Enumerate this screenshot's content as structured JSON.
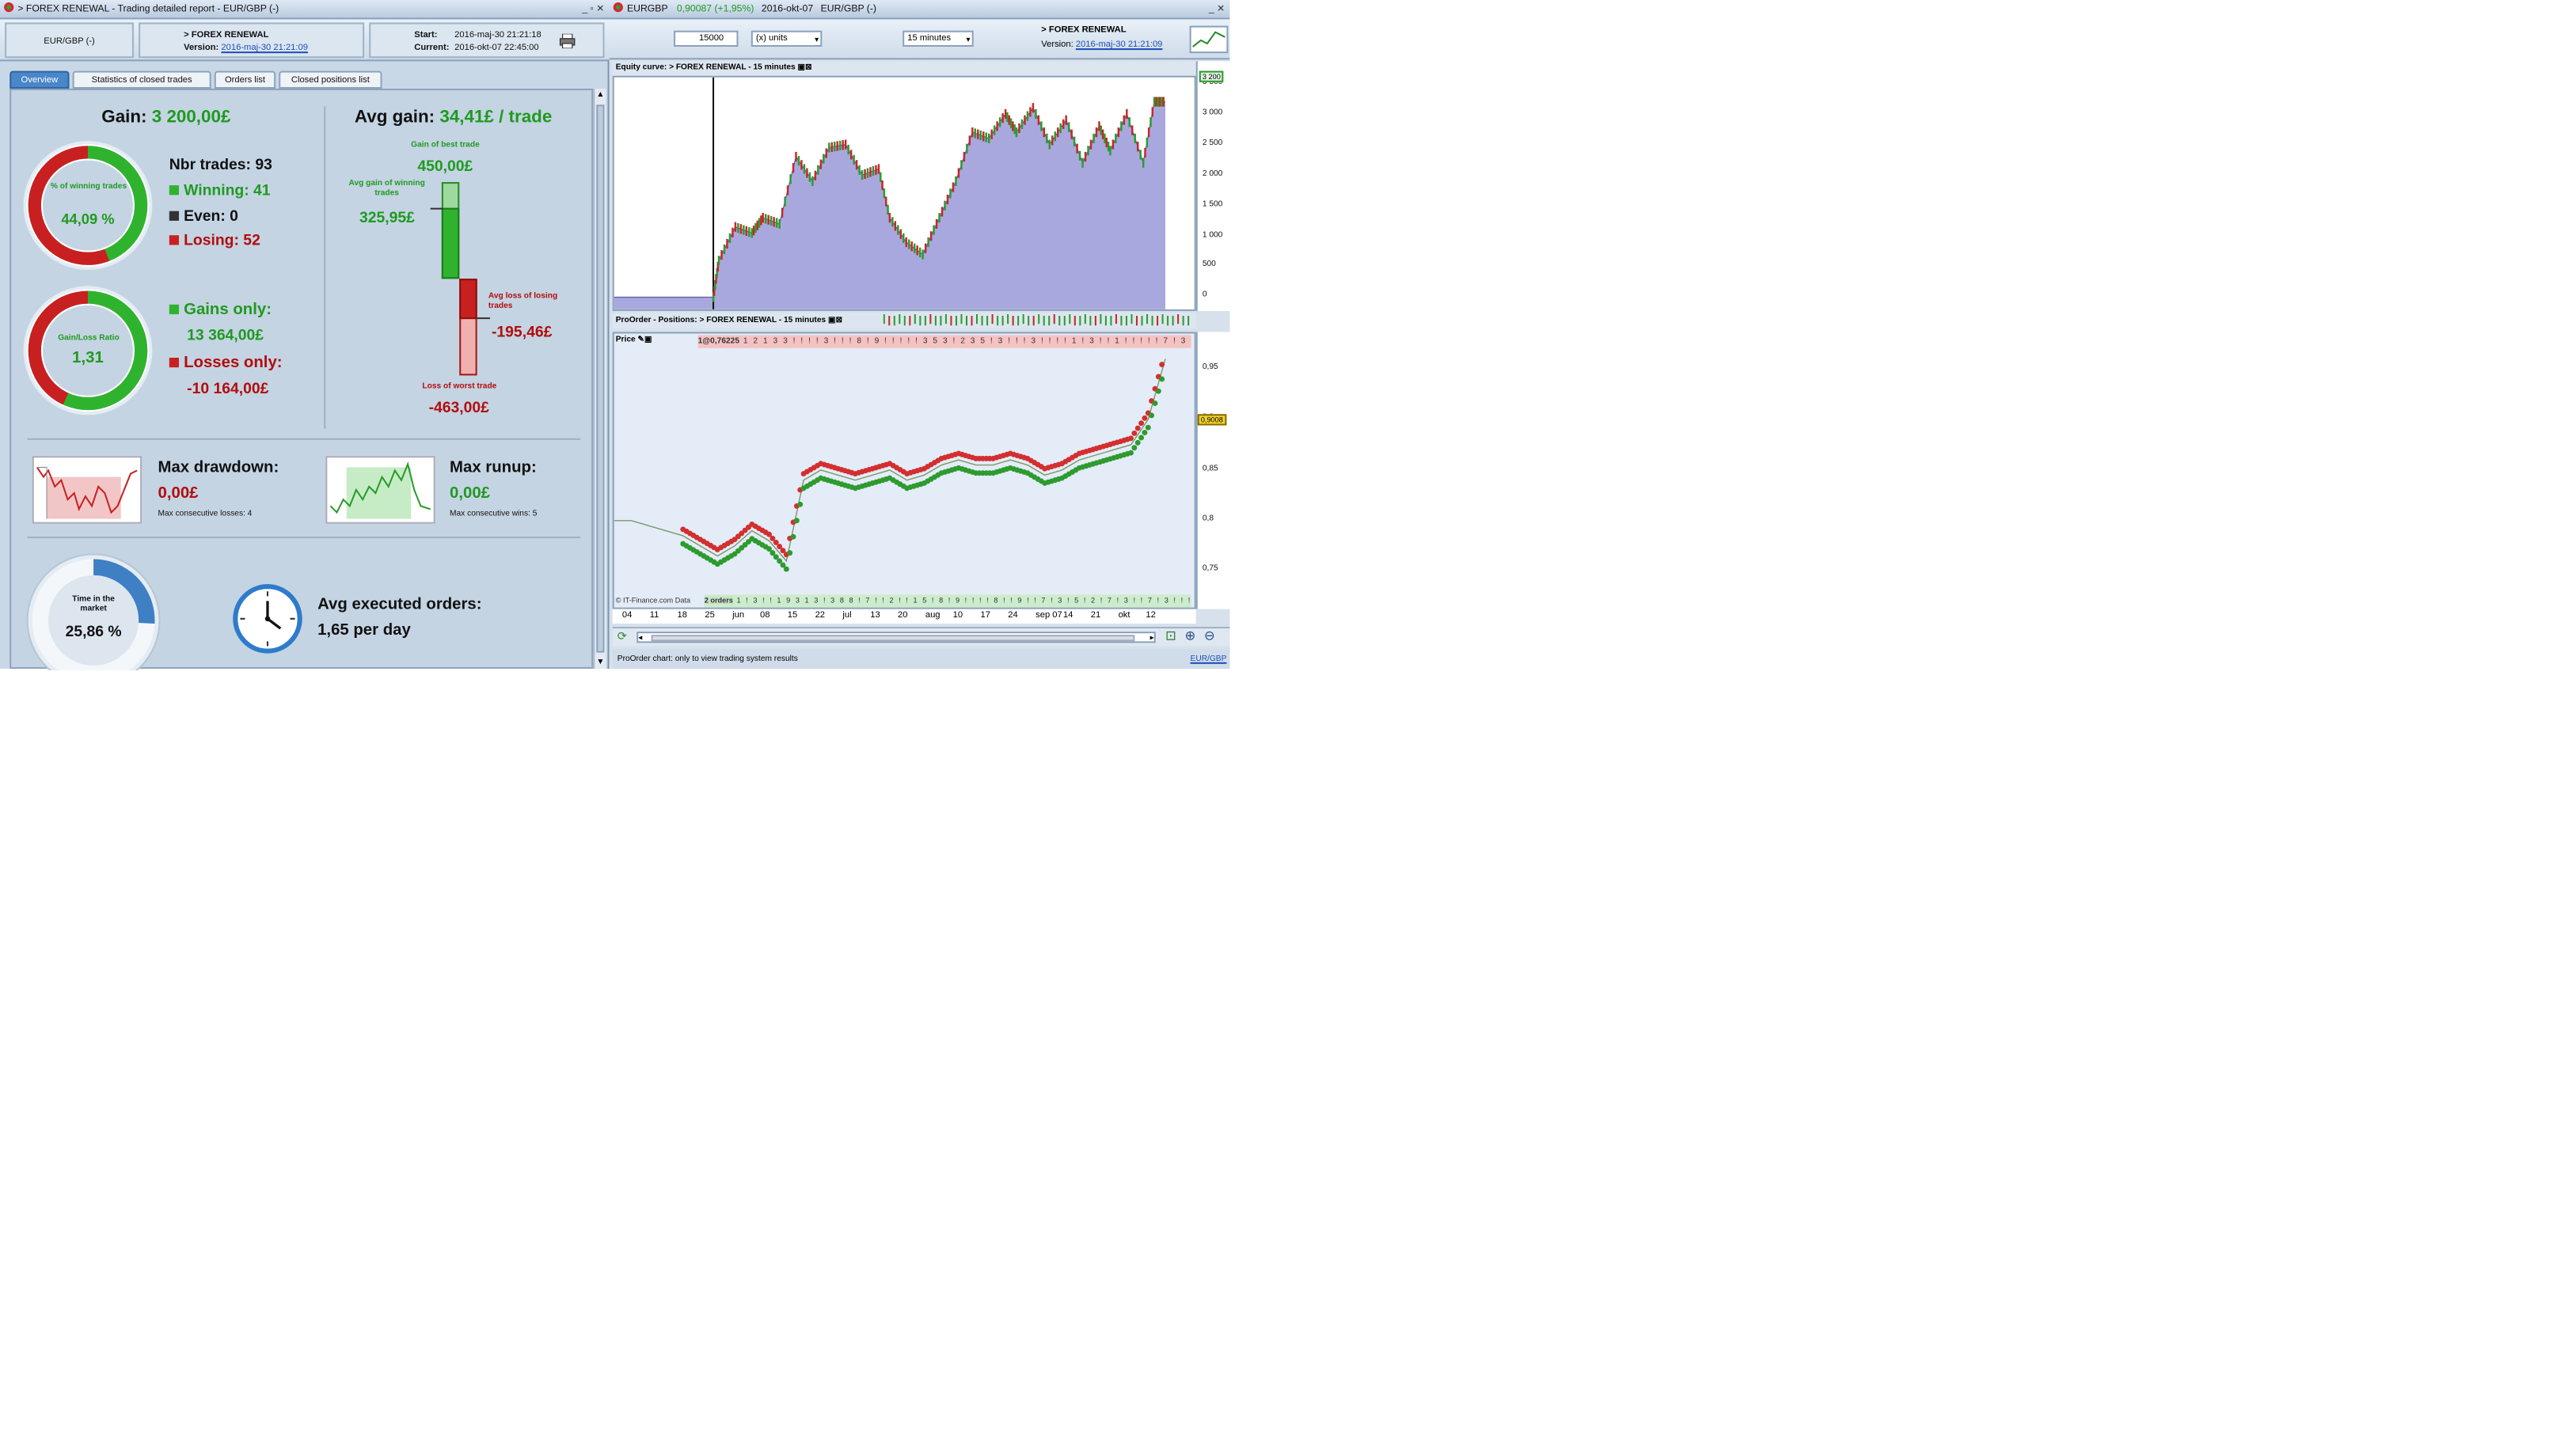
{
  "left_window": {
    "title": "> FOREX RENEWAL - Trading detailed report - EUR/GBP (-)",
    "instrument": "EUR/GBP (-)",
    "system_name": "> FOREX RENEWAL",
    "version_label": "Version:",
    "version_date": "2016-maj-30 21:21:09",
    "start_label": "Start:",
    "start_value": "2016-maj-30 21:21:18",
    "current_label": "Current:",
    "current_value": "2016-okt-07 22:45:00",
    "tabs": [
      "Overview",
      "Statistics of closed trades",
      "Orders list",
      "Closed positions list"
    ],
    "gain_label": "Gain:",
    "gain_value": "3 200,00£",
    "pct_winning_label": "% of winning trades",
    "pct_winning_value": "44,09 %",
    "pct_winning_fraction": 0.4409,
    "nbr_trades_label": "Nbr trades: 93",
    "winning_label": "Winning: 41",
    "even_label": "Even: 0",
    "losing_label": "Losing: 52",
    "gain_loss_ratio_label": "Gain/Loss Ratio",
    "gain_loss_ratio_value": "1,31",
    "gains_only_label": "Gains only:",
    "gains_only_value": "13 364,00£",
    "losses_only_label": "Losses only:",
    "losses_only_value": "-10 164,00£",
    "avg_gain_label": "Avg gain:",
    "avg_gain_value": "34,41£ / trade",
    "best_trade_label": "Gain of best trade",
    "best_trade_value": "450,00£",
    "avg_gain_winning_label": "Avg gain of winning trades",
    "avg_gain_winning_value": "325,95£",
    "avg_loss_losing_label": "Avg loss of losing trades",
    "avg_loss_losing_value": "-195,46£",
    "worst_trade_label": "Loss of worst trade",
    "worst_trade_value": "-463,00£",
    "max_drawdown_label": "Max drawdown:",
    "max_drawdown_value": "0,00£",
    "max_consec_losses": "Max consecutive losses: 4",
    "max_runup_label": "Max runup:",
    "max_runup_value": "0,00£",
    "max_consec_wins": "Max consecutive wins: 5",
    "time_in_market_label": "Time in the market",
    "time_in_market_value": "25,86 %",
    "time_in_market_fraction": 0.2586,
    "avg_orders_label": "Avg executed orders:",
    "avg_orders_value": "1,65 per day"
  },
  "right_window": {
    "title_symbol": "EURGBP",
    "title_price": "0,90087 (+1,95%)",
    "title_date": "2016-okt-07",
    "title_instrument": "EUR/GBP (-)",
    "quantity": "15000",
    "units": "(x) units",
    "timeframe": "15 minutes",
    "system_name": "> FOREX RENEWAL",
    "version_label": "Version:",
    "version_date": "2016-maj-30 21:21:09",
    "equity_title": "Equity curve: > FOREX RENEWAL - 15 minutes",
    "positions_title": "ProOrder - Positions: > FOREX RENEWAL - 15 minutes",
    "price_label": "Price",
    "order_tag": "1@0,76225",
    "orders_tag": "2 orders",
    "copyright": "© IT-Finance.com  Data",
    "status_text": "ProOrder chart: only to view trading system results",
    "status_instrument": "EUR/GBP",
    "current_price_tag": "0,9008",
    "equity_last_tag": "3 200"
  },
  "chart_data": [
    {
      "type": "area",
      "title": "Equity curve: > FOREX RENEWAL - 15 minutes",
      "y_ticks": [
        "3 500",
        "3 000",
        "2 500",
        "2 000",
        "1 500",
        "1 000",
        "500",
        "0"
      ],
      "ylim": [
        -200,
        3600
      ],
      "x": [
        0,
        0.18,
        0.19,
        0.22,
        0.25,
        0.27,
        0.3,
        0.33,
        0.36,
        0.39,
        0.42,
        0.45,
        0.48,
        0.5,
        0.53,
        0.56,
        0.59,
        0.62,
        0.65,
        0.68,
        0.71,
        0.73,
        0.76,
        0.79,
        0.82,
        0.85,
        0.88,
        0.9,
        0.93,
        0.96,
        0.98,
        1.0
      ],
      "values": [
        0,
        0,
        600,
        1150,
        1050,
        1300,
        1200,
        2300,
        1900,
        2450,
        2500,
        2000,
        2100,
        1300,
        900,
        700,
        1300,
        1900,
        2700,
        2600,
        3000,
        2700,
        3100,
        2500,
        2900,
        2200,
        2800,
        2400,
        3000,
        2200,
        3200,
        3200
      ],
      "markers": {
        "green": "#2d9b2d",
        "red": "#c62828"
      }
    },
    {
      "type": "line",
      "title": "Price",
      "y_ticks": [
        "0,95",
        "0,9",
        "0,85",
        "0,8",
        "0,75"
      ],
      "ylim": [
        0.73,
        0.985
      ],
      "x_ticks": [
        "04",
        "11",
        "18",
        "25",
        "jun",
        "08",
        "15",
        "22",
        "jul",
        "13",
        "20",
        "aug",
        "10",
        "17",
        "24",
        "sep 07",
        "14",
        "21",
        "okt",
        "12"
      ],
      "series": [
        {
          "values": [
            0.8,
            0.8,
            0.795,
            0.79,
            0.785,
            0.775,
            0.765,
            0.775,
            0.79,
            0.78,
            0.76,
            0.84,
            0.85,
            0.845,
            0.84,
            0.845,
            0.85,
            0.84,
            0.845,
            0.855,
            0.86,
            0.855,
            0.855,
            0.86,
            0.855,
            0.845,
            0.85,
            0.86,
            0.865,
            0.87,
            0.875,
            0.9,
            0.96
          ]
        }
      ]
    }
  ]
}
